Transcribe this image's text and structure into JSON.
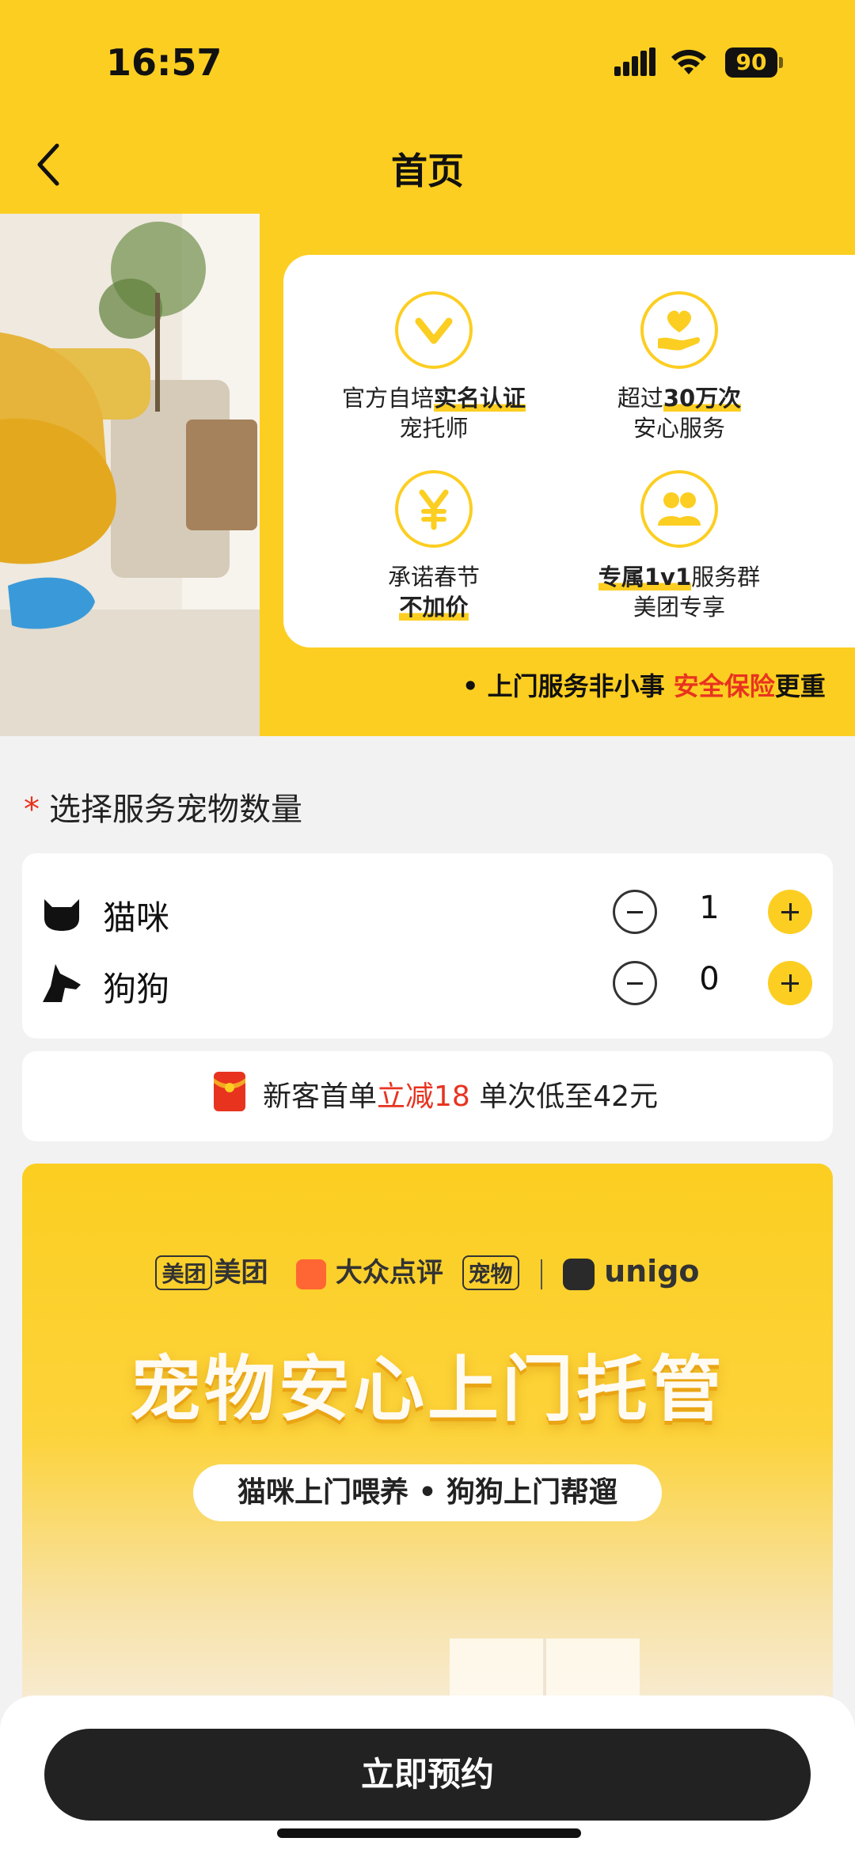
{
  "status_bar": {
    "time": "16:57",
    "battery": "90"
  },
  "header": {
    "title": "首页"
  },
  "banner": {
    "promises": [
      {
        "icon": "check-v-icon",
        "line1_plain": "官方自培",
        "line1_hl": "实名认证",
        "line2_plain": "宠托师",
        "line2_hl": ""
      },
      {
        "icon": "heart-hand-icon",
        "line1_plain": "超过",
        "line1_hl": "30万次",
        "line2_plain": "安心服务",
        "line2_hl": ""
      },
      {
        "icon": "yen-icon",
        "line1_plain": "承诺春节",
        "line1_hl": "",
        "line2_plain": "",
        "line2_hl": "不加价"
      },
      {
        "icon": "group-icon",
        "line1_plain": "服务群",
        "line1_hl": "专属1v1",
        "line2_plain": "美团专享",
        "line2_hl": ""
      }
    ],
    "safety": {
      "prefix": "• 上门服务非小事 ",
      "highlight": "安全保险",
      "suffix": "更重"
    }
  },
  "pet_section": {
    "title": "选择服务宠物数量",
    "required_mark": "*",
    "pets": [
      {
        "icon": "cat-icon",
        "label": "猫咪",
        "count": "1"
      },
      {
        "icon": "dog-icon",
        "label": "狗狗",
        "count": "0"
      }
    ]
  },
  "coupon": {
    "prefix": "新客首单",
    "highlight": "立减18",
    "suffix": " 单次低至42元"
  },
  "poster": {
    "brands": {
      "meituan": "美团",
      "dianping": "大众点评",
      "pet": "宠物",
      "unigo": "unigo"
    },
    "headline": "宠物安心上门托管",
    "subtitle": "猫咪上门喂养 • 狗狗上门帮遛"
  },
  "cta": {
    "label": "立即预约"
  },
  "colors": {
    "accent": "#fcce21",
    "red": "#e8331f",
    "dark": "#222222"
  }
}
